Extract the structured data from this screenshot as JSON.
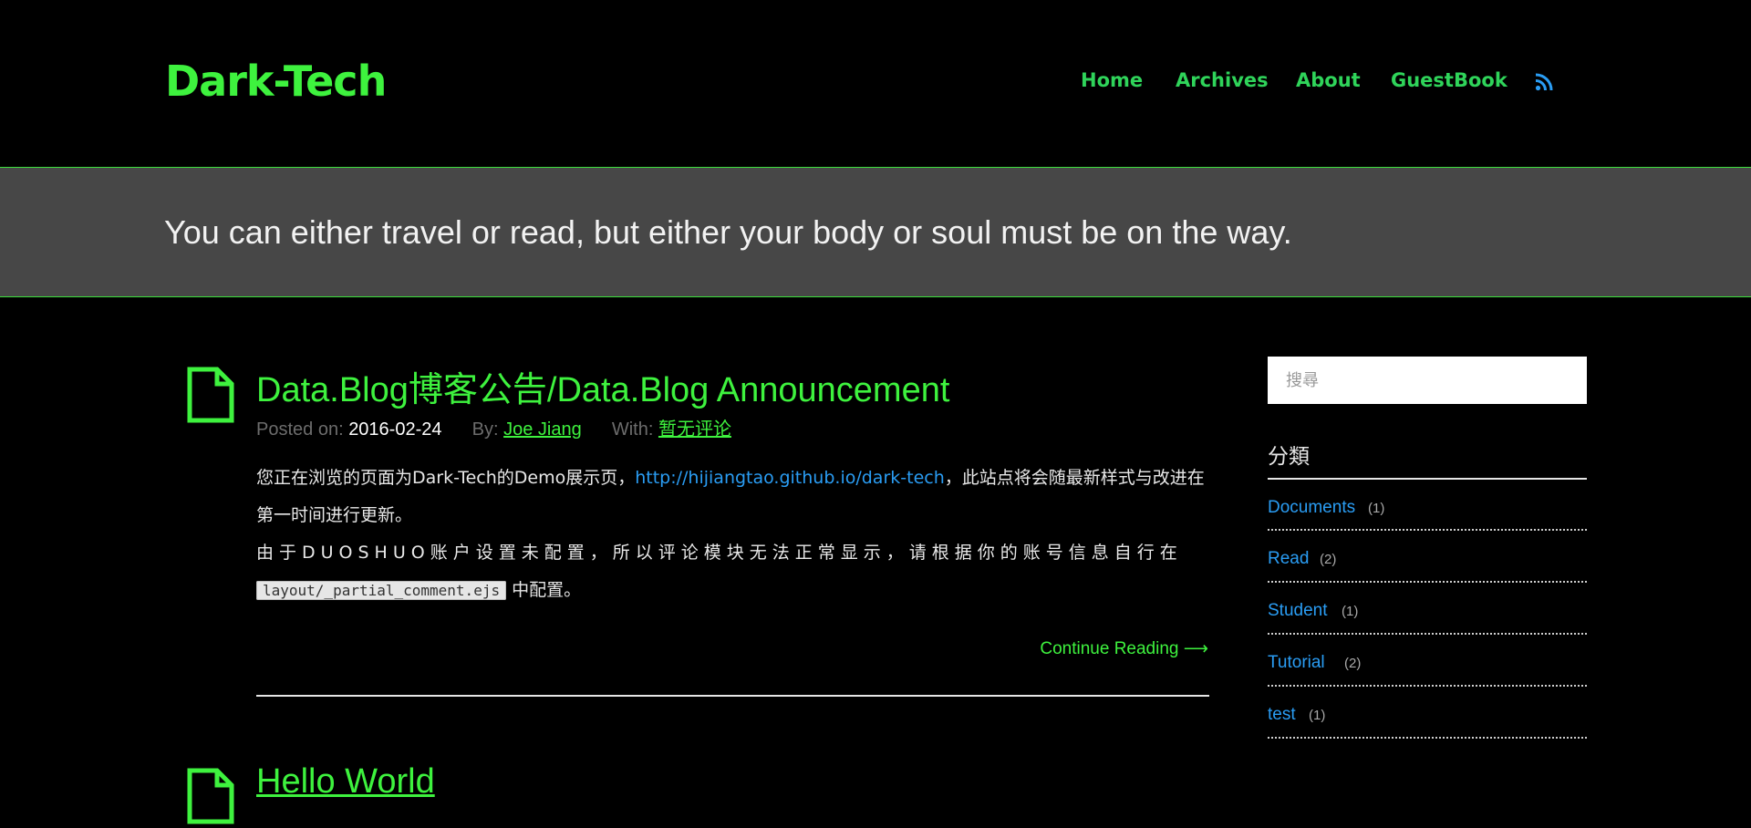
{
  "header": {
    "logo": "Dark-Tech",
    "nav": [
      {
        "label": "Home"
      },
      {
        "label": "Archives"
      },
      {
        "label": "About"
      },
      {
        "label": "GuestBook"
      }
    ],
    "rss_icon": "rss-icon",
    "accent_color": "#3ef23e",
    "nav_color": "#2fd45a"
  },
  "banner": {
    "tagline": "You can either travel or read, but either your body or soul must be on the way."
  },
  "post": {
    "icon": "document-icon",
    "title": "Data.Blog博客公告/Data.Blog Announcement",
    "meta": {
      "posted_label": "Posted on:",
      "posted_date": "2016-02-24",
      "by_label": "By:",
      "author": "Joe Jiang",
      "with_label": "With:",
      "comments": "暂无评论"
    },
    "para1_before": "您正在浏览的页面为Dark-Tech的Demo展示页，",
    "para1_link": "http://hijiangtao.github.io/dark-tech",
    "para1_after": "，此站点将会随最新样式与改进在第一时间进行更新。",
    "para2_before": "由于DUOSHUO账户设置未配置，所以评论模块无法正常显示，请根据你的账号信息自行在",
    "para2_code": "layout/_partial_comment.ejs",
    "para2_after": " 中配置。",
    "continue_label": "Continue Reading ⟶"
  },
  "next_post": {
    "title": "Hello World"
  },
  "sidebar": {
    "search_placeholder": "搜尋",
    "categories_title": "分類",
    "categories": [
      {
        "name": "Documents",
        "count": "(1)"
      },
      {
        "name": "Read",
        "count": "(2)"
      },
      {
        "name": "Student",
        "count": "(1)"
      },
      {
        "name": "Tutorial",
        "count": "(2)"
      },
      {
        "name": "test",
        "count": "(1)"
      }
    ],
    "link_color": "#2a9df4"
  }
}
